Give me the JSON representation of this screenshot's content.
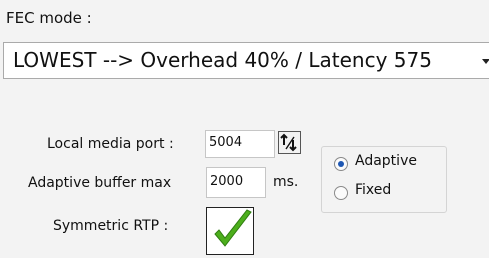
{
  "fec": {
    "label": "FEC mode :",
    "selected": "LOWEST --> Overhead 40% / Latency 575"
  },
  "local_media_port": {
    "label": "Local media port :",
    "value": "5004"
  },
  "adaptive_buffer": {
    "label": "Adaptive buffer max",
    "value": "2000",
    "unit": "ms."
  },
  "buffer_mode": {
    "options": [
      {
        "label": "Adaptive",
        "selected": true
      },
      {
        "label": "Fixed",
        "selected": false
      }
    ]
  },
  "symmetric_rtp": {
    "label": "Symmetric RTP :",
    "checked": true
  },
  "icons": {
    "spin": "up-down-spinner-icon",
    "check": "green-checkmark-icon",
    "dropdown": "chevron-down-icon"
  },
  "colors": {
    "check_green": "#4cae1c",
    "radio_selected": "#1e57b3"
  }
}
